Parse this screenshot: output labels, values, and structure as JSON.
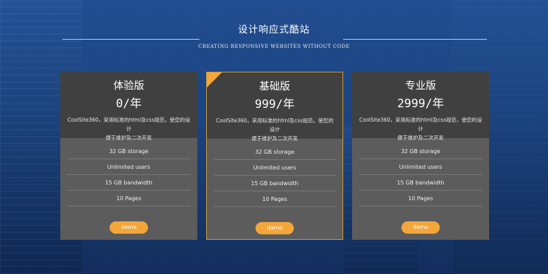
{
  "header": {
    "title": "设计响应式酷站",
    "subtitle": "CREATING RESPONSIVE WEBSITES WITHOUT CODE"
  },
  "plans": [
    {
      "name": "体验版",
      "price": "0/年",
      "description_lines": [
        "CoolSite360，采用标准的html及css规范，使您的设计",
        "便于维护及二次开发"
      ],
      "features": [
        "32 GB storage",
        "Unlimited users",
        "15 GB bandwidth",
        "10 Pages"
      ],
      "demo_label": "demo"
    },
    {
      "name": "基础版",
      "price": "999/年",
      "description_lines": [
        "CoolSite360，采用标准的html及css规范，使您的设计",
        "便于维护及二次开发"
      ],
      "features": [
        "32 GB storage",
        "Unlimited users",
        "15 GB bandwidth",
        "10 Pages"
      ],
      "demo_label": "demo"
    },
    {
      "name": "专业版",
      "price": "2999/年",
      "description_lines": [
        "CoolSite360，采用标准的html及css规范，使您的设计",
        "便于维护及二次开发"
      ],
      "features": [
        "32 GB storage",
        "Unlimited users",
        "15 GB bandwidth",
        "10 Pages"
      ],
      "demo_label": "demo"
    }
  ],
  "colors": {
    "background": "#1f467f",
    "card_top": "#404040",
    "card_body": "#5c5c5c",
    "accent": "#f3a63a",
    "highlight_border": "#d59f2d"
  }
}
